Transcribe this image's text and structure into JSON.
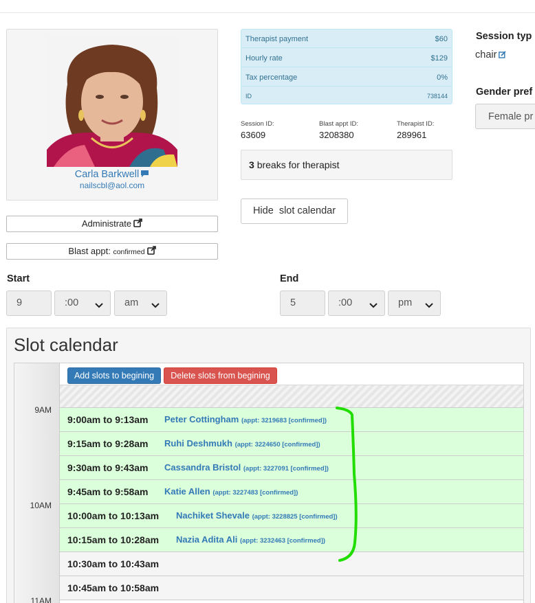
{
  "profile": {
    "name": "Carla Barkwell",
    "email": "nailscbl@aol.com",
    "administrate_label": "Administrate",
    "blast_label": "Blast appt:",
    "blast_status": "confirmed"
  },
  "info": {
    "rows": [
      {
        "label": "Therapist payment",
        "value": "$60"
      },
      {
        "label": "Hourly rate",
        "value": "$129"
      },
      {
        "label": "Tax percentage",
        "value": "0%"
      },
      {
        "label": "ID",
        "value": "738144"
      }
    ]
  },
  "ids": {
    "session_label": "Session ID:",
    "session_value": "63609",
    "blast_label": "Blast appt ID:",
    "blast_value": "3208380",
    "therapist_label": "Therapist ID:",
    "therapist_value": "289961"
  },
  "breaks": {
    "count": "3",
    "text": "breaks for therapist"
  },
  "hide_slot_button": "Hide  slot calendar",
  "session_type": {
    "title": "Session typ",
    "value": "chair"
  },
  "gender": {
    "title": "Gender pref",
    "value": "Female pr"
  },
  "time": {
    "start_label": "Start",
    "start_hour": "9",
    "start_min": ":00",
    "start_ampm": "am",
    "end_label": "End",
    "end_hour": "5",
    "end_min": ":00",
    "end_ampm": "pm"
  },
  "slot_calendar": {
    "title": "Slot calendar",
    "add_button": "Add slots to begining",
    "delete_button": "Delete slots from begining",
    "hours": [
      "9AM",
      "10AM",
      "11AM"
    ],
    "slots": [
      {
        "time": "9:00am to 9:13am",
        "name": "Peter Cottingham",
        "meta": "(appt: 3219683 [confirmed])"
      },
      {
        "time": "9:15am to 9:28am",
        "name": "Ruhi Deshmukh",
        "meta": "(appt: 3224650 [confirmed])"
      },
      {
        "time": "9:30am to 9:43am",
        "name": "Cassandra Bristol",
        "meta": "(appt: 3227091 [confirmed])"
      },
      {
        "time": "9:45am to 9:58am",
        "name": "Katie Allen",
        "meta": "(appt: 3227483 [confirmed])"
      },
      {
        "time": "10:00am to 10:13am",
        "name": "Nachiket Shevale",
        "meta": "(appt: 3228825 [confirmed])"
      },
      {
        "time": "10:15am to 10:28am",
        "name": "Nazia Adita Ali",
        "meta": "(appt: 3232463 [confirmed])"
      },
      {
        "time": "10:30am to 10:43am",
        "name": "",
        "meta": ""
      },
      {
        "time": "10:45am to 10:58am",
        "name": "",
        "meta": ""
      }
    ]
  },
  "colors": {
    "link": "#337ab7",
    "booked_bg": "#dbffdb",
    "add_button": "#337ab7",
    "delete_button": "#d9534f",
    "info_bg": "#d9edf7",
    "annotation": "#22dd00"
  },
  "icons": [
    "chat-icon",
    "external-link-icon",
    "edit-icon",
    "chevron-down-icon"
  ]
}
